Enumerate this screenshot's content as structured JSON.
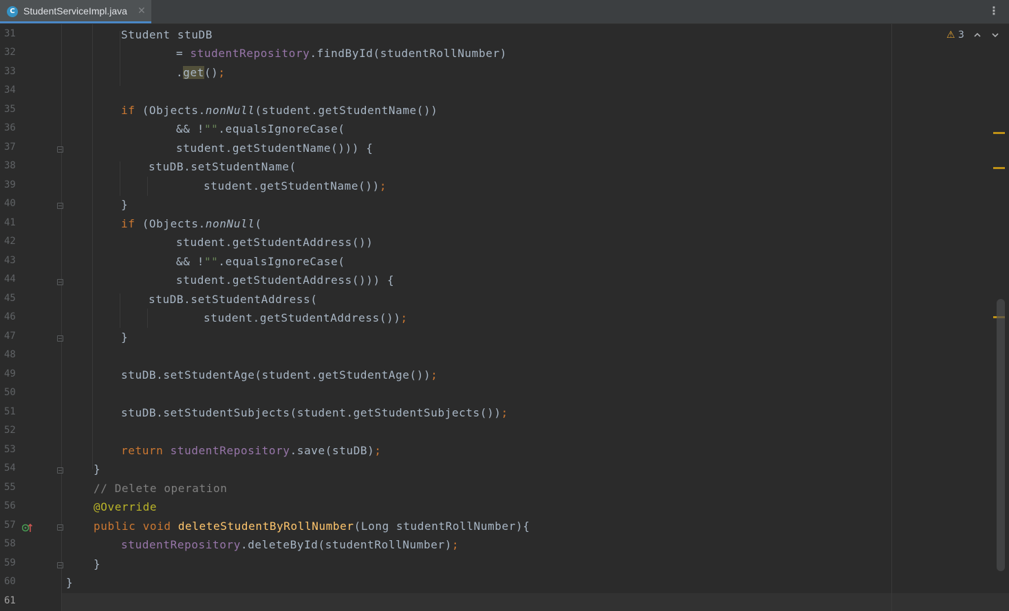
{
  "tab": {
    "icon_letter": "C",
    "icon_name": "java-class-icon",
    "filename": "StudentServiceImpl.java",
    "close_glyph": "✕"
  },
  "toolbar": {
    "more_glyph": "⋮"
  },
  "inspections": {
    "warning_glyph": "⚠",
    "warning_count": "3"
  },
  "lines": [
    {
      "num": "31",
      "text": "Student stuDB"
    },
    {
      "num": "32",
      "text": "= studentRepository.findById(studentRollNumber)"
    },
    {
      "num": "33",
      "text": ".get();"
    },
    {
      "num": "34",
      "text": ""
    },
    {
      "num": "35",
      "text": "if (Objects.nonNull(student.getStudentName())"
    },
    {
      "num": "36",
      "text": "&& !\"\".equalsIgnoreCase("
    },
    {
      "num": "37",
      "text": "student.getStudentName())) {"
    },
    {
      "num": "38",
      "text": "stuDB.setStudentName("
    },
    {
      "num": "39",
      "text": "student.getStudentName());"
    },
    {
      "num": "40",
      "text": "}"
    },
    {
      "num": "41",
      "text": "if (Objects.nonNull("
    },
    {
      "num": "42",
      "text": "student.getStudentAddress())"
    },
    {
      "num": "43",
      "text": "&& !\"\".equalsIgnoreCase("
    },
    {
      "num": "44",
      "text": "student.getStudentAddress())) {"
    },
    {
      "num": "45",
      "text": "stuDB.setStudentAddress("
    },
    {
      "num": "46",
      "text": "student.getStudentAddress());"
    },
    {
      "num": "47",
      "text": "}"
    },
    {
      "num": "48",
      "text": ""
    },
    {
      "num": "49",
      "text": "stuDB.setStudentAge(student.getStudentAge());"
    },
    {
      "num": "50",
      "text": ""
    },
    {
      "num": "51",
      "text": "stuDB.setStudentSubjects(student.getStudentSubjects());"
    },
    {
      "num": "52",
      "text": ""
    },
    {
      "num": "53",
      "text": "return studentRepository.save(stuDB);"
    },
    {
      "num": "54",
      "text": "}"
    },
    {
      "num": "55",
      "text": "// Delete operation"
    },
    {
      "num": "56",
      "text": "@Override"
    },
    {
      "num": "57",
      "text": "public void deleteStudentByRollNumber(Long studentRollNumber){"
    },
    {
      "num": "58",
      "text": "studentRepository.deleteById(studentRollNumber);"
    },
    {
      "num": "59",
      "text": "}"
    },
    {
      "num": "60",
      "text": "}"
    },
    {
      "num": "61",
      "text": ""
    }
  ],
  "tokens": {
    "l31": [
      "Student stuDB"
    ],
    "l32": [
      "= ",
      "studentRepository",
      ".findById(studentRollNumber)"
    ],
    "l33": [
      ".",
      "get",
      "()",
      ";"
    ],
    "l35": [
      "if",
      " (Objects.",
      "nonNull",
      "(student.getStudentName())"
    ],
    "l36": [
      "&& !",
      "\"\"",
      ".equalsIgnoreCase("
    ],
    "l37": [
      "student.getStudentName())) {"
    ],
    "l38": [
      "stuDB.setStudentName("
    ],
    "l39": [
      "student.getStudentName())",
      ";"
    ],
    "l40": [
      "}"
    ],
    "l41": [
      "if",
      " (Objects.",
      "nonNull",
      "("
    ],
    "l42": [
      "student.getStudentAddress())"
    ],
    "l43": [
      "&& !",
      "\"\"",
      ".equalsIgnoreCase("
    ],
    "l44": [
      "student.getStudentAddress())) {"
    ],
    "l45": [
      "stuDB.setStudentAddress("
    ],
    "l46": [
      "student.getStudentAddress())",
      ";"
    ],
    "l47": [
      "}"
    ],
    "l49": [
      "stuDB.setStudentAge(student.getStudentAge())",
      ";"
    ],
    "l51": [
      "stuDB.setStudentSubjects(student.getStudentSubjects())",
      ";"
    ],
    "l53": [
      "return",
      " ",
      "studentRepository",
      ".save(stuDB)",
      ";"
    ],
    "l54": [
      "}"
    ],
    "l55": [
      "// Delete operation"
    ],
    "l56": [
      "@Override"
    ],
    "l57": [
      "public",
      " ",
      "void",
      " ",
      "deleteStudentByRollNumber",
      "(Long studentRollNumber){"
    ],
    "l58": [
      "studentRepository",
      ".deleteById(studentRollNumber)",
      ";"
    ],
    "l59": [
      "}"
    ],
    "l60": [
      "}"
    ]
  },
  "colors": {
    "editor_bg": "#2b2b2b",
    "keyword": "#cc7832",
    "field": "#9876aa",
    "string": "#6a8759",
    "comment": "#808080",
    "annotation": "#bbb529",
    "method_decl": "#ffc66d",
    "plain": "#a9b7c6",
    "warning_marker": "#be9117",
    "tab_underline": "#4a88c7"
  }
}
